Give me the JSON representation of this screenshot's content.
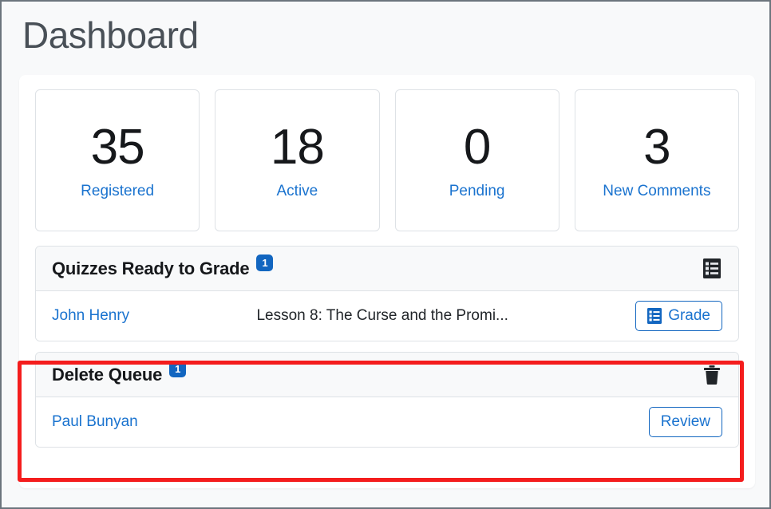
{
  "page": {
    "title": "Dashboard"
  },
  "stats": [
    {
      "value": "35",
      "label": "Registered",
      "name": "registered"
    },
    {
      "value": "18",
      "label": "Active",
      "name": "active"
    },
    {
      "value": "0",
      "label": "Pending",
      "name": "pending"
    },
    {
      "value": "3",
      "label": "New Comments",
      "name": "new-comments"
    }
  ],
  "quizzes_card": {
    "title": "Quizzes Ready to Grade",
    "badge": "1",
    "header_icon": "list-alt-icon",
    "row": {
      "student": "John Henry",
      "lesson": "Lesson 8: The Curse and the Promi...",
      "button_label": "Grade",
      "button_icon": "list-alt-icon"
    }
  },
  "delete_queue_card": {
    "title": "Delete Queue",
    "badge": "1",
    "header_icon": "trash-icon",
    "row": {
      "student": "Paul Bunyan",
      "button_label": "Review"
    }
  },
  "colors": {
    "link": "#1a73cf",
    "badge": "#1266c0",
    "highlight": "#f41d1d",
    "page_bg": "#f8f9fa",
    "border": "#dee2e6"
  }
}
